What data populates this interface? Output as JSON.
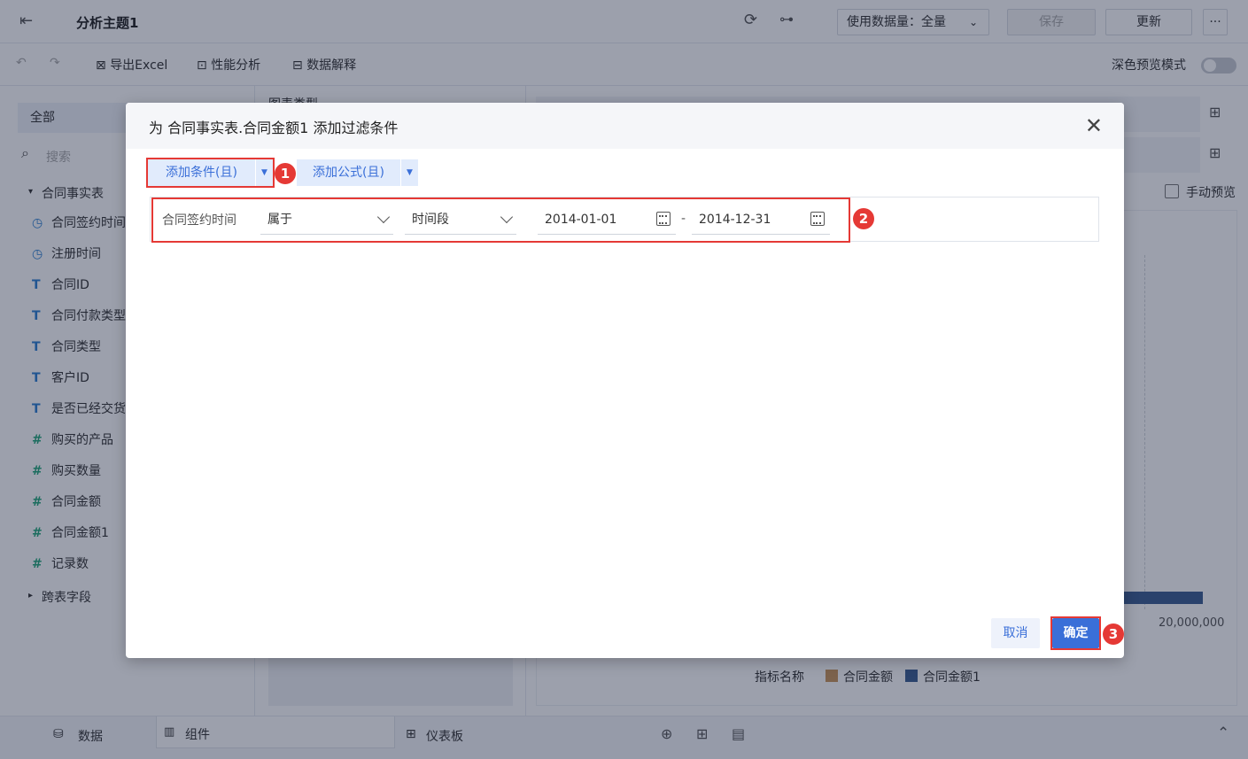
{
  "topbar": {
    "title": "分析主题1",
    "data_amount_label": "使用数据量：全量",
    "save_label": "保存",
    "update_label": "更新",
    "more_label": "···"
  },
  "toolbar": {
    "export_excel": "导出Excel",
    "perf_analysis": "性能分析",
    "data_explain": "数据解释",
    "dark_preview": "深色预览模式"
  },
  "sidebar": {
    "all_label": "全部",
    "search_placeholder": "搜索",
    "table_name": "合同事实表",
    "fields": [
      {
        "icon": "clock-icon",
        "label": "合同签约时间"
      },
      {
        "icon": "clock-icon",
        "label": "注册时间"
      },
      {
        "icon": "text-type-icon",
        "label": "合同ID"
      },
      {
        "icon": "text-type-icon",
        "label": "合同付款类型"
      },
      {
        "icon": "text-type-icon",
        "label": "合同类型"
      },
      {
        "icon": "text-type-icon",
        "label": "客户ID"
      },
      {
        "icon": "text-type-icon",
        "label": "是否已经交货"
      },
      {
        "icon": "hash-icon",
        "label": "购买的产品"
      },
      {
        "icon": "hash-icon",
        "label": "购买数量"
      },
      {
        "icon": "hash-icon",
        "label": "合同金额"
      },
      {
        "icon": "hash-icon",
        "label": "合同金额1"
      },
      {
        "icon": "hash-star-icon",
        "label": "记录数"
      }
    ],
    "cross_table": "跨表字段"
  },
  "middle": {
    "chart_type_label": "图表类型"
  },
  "chart_area": {
    "manual_preview": "手动预览",
    "axis_tick": "20,000,000",
    "legend_title": "指标名称",
    "legend": [
      {
        "name": "合同金额",
        "color": "#c8955a"
      },
      {
        "name": "合同金额1",
        "color": "#3b5d91"
      }
    ]
  },
  "bottombar": {
    "data_tab": "数据",
    "component_tab": "组件",
    "dashboard_tab": "仪表板"
  },
  "dialog": {
    "title": "为 合同事实表.合同金额1 添加过滤条件",
    "add_condition": "添加条件(且)",
    "add_formula": "添加公式(且)",
    "condition": {
      "field": "合同签约时间",
      "operator": "属于",
      "range_type": "时间段",
      "start_date": "2014-01-01",
      "separator": "-",
      "end_date": "2014-12-31"
    },
    "cancel": "取消",
    "ok": "确定",
    "badges": [
      "1",
      "2",
      "3"
    ]
  },
  "colors": {
    "accent": "#3a6fd8",
    "highlight": "#e53935",
    "overlay": "rgba(18,28,58,0.42)"
  }
}
